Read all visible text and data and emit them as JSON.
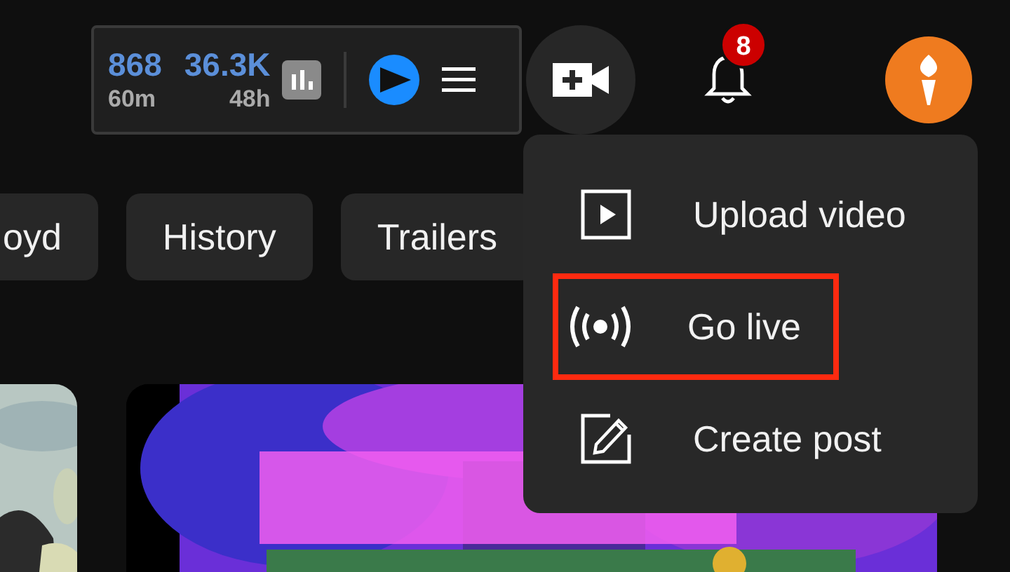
{
  "stats": [
    {
      "value": "868",
      "period": "60m"
    },
    {
      "value": "36.3K",
      "period": "48h"
    }
  ],
  "notifications": {
    "count": "8"
  },
  "chips": [
    {
      "label": "oyd"
    },
    {
      "label": "History"
    },
    {
      "label": "Trailers"
    }
  ],
  "create_menu": [
    {
      "kind": "upload",
      "label": "Upload video",
      "highlighted": false
    },
    {
      "kind": "live",
      "label": "Go live",
      "highlighted": true
    },
    {
      "kind": "post",
      "label": "Create post",
      "highlighted": false
    }
  ]
}
